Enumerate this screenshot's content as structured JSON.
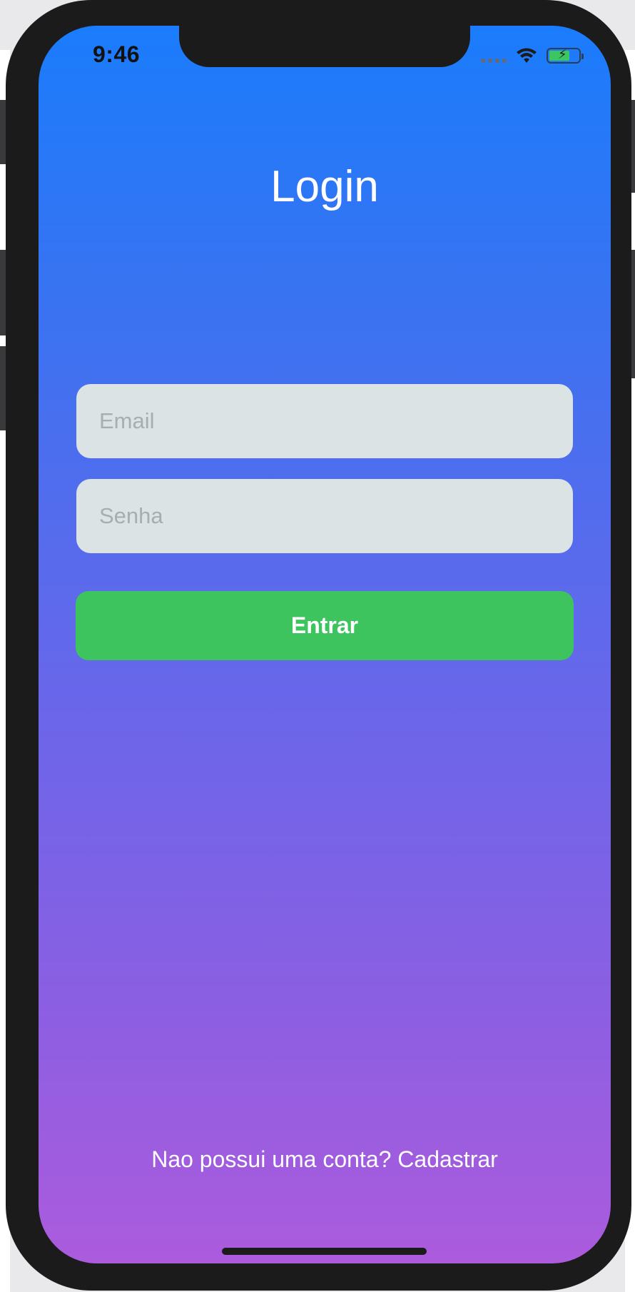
{
  "status_bar": {
    "time": "9:46",
    "icons": [
      "cellular-signal-icon",
      "wifi-icon",
      "battery-charging-icon"
    ]
  },
  "screen": {
    "title": "Login",
    "email_placeholder": "Email",
    "password_placeholder": "Senha",
    "submit_label": "Entrar",
    "signup_text": "Nao possui uma conta? Cadastrar"
  },
  "colors": {
    "gradient_top": "#1a7cfc",
    "gradient_bottom": "#ac5bdd",
    "field_bg": "#dbe3e5",
    "button_green": "#3dc45e",
    "text_white": "#ffffff"
  }
}
